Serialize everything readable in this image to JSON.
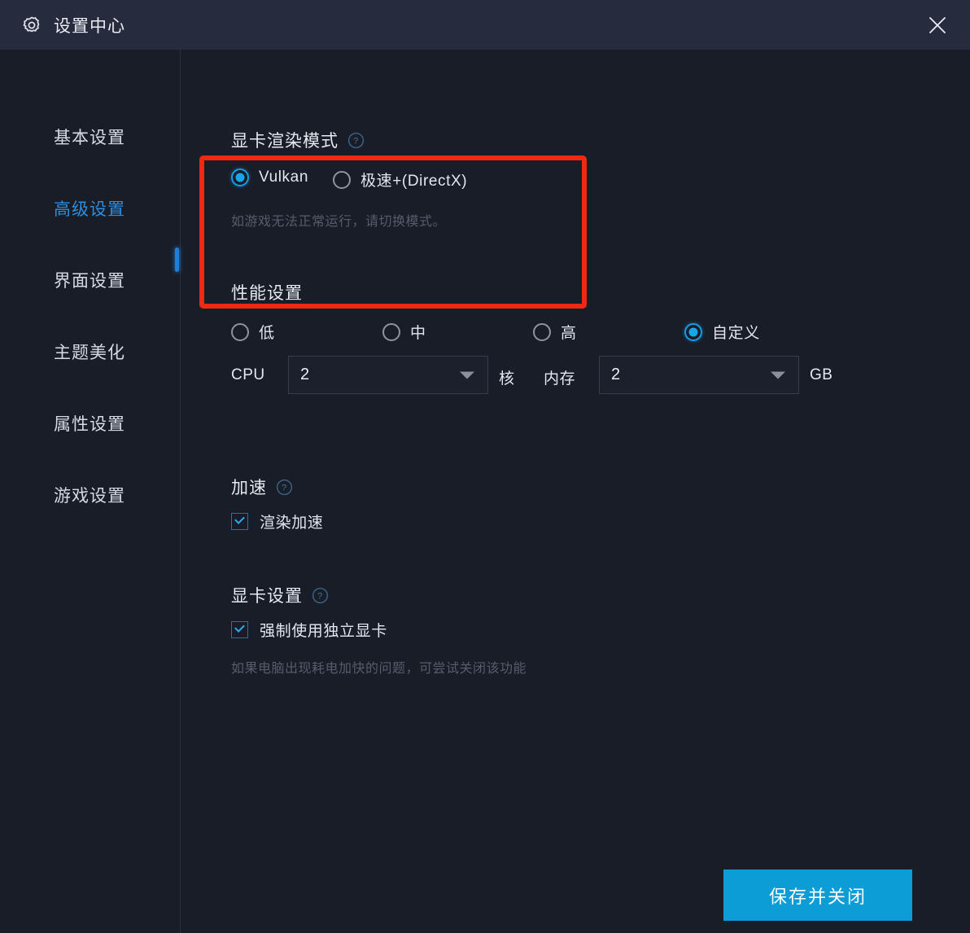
{
  "window": {
    "title": "设置中心",
    "gear_icon": "gear-icon",
    "close_icon": "close-icon",
    "titlebar_color": "#262c3d",
    "background_color": "#191d28",
    "accent_color": "#17a7e8",
    "highlight_color": "#f02a12"
  },
  "sidebar": {
    "items": [
      {
        "label": "基本设置",
        "active": false
      },
      {
        "label": "高级设置",
        "active": true
      },
      {
        "label": "界面设置",
        "active": false
      },
      {
        "label": "主题美化",
        "active": false
      },
      {
        "label": "属性设置",
        "active": false
      },
      {
        "label": "游戏设置",
        "active": false
      }
    ]
  },
  "main": {
    "render_mode": {
      "title": "显卡渲染模式",
      "help_icon": "help-circle-icon",
      "options": [
        {
          "label": "Vulkan",
          "selected": true
        },
        {
          "label": "极速+(DirectX)",
          "selected": false
        }
      ],
      "hint": "如游戏无法正常运行，请切换模式。"
    },
    "performance": {
      "title": "性能设置",
      "options": [
        {
          "label": "低",
          "selected": false
        },
        {
          "label": "中",
          "selected": false
        },
        {
          "label": "高",
          "selected": false
        },
        {
          "label": "自定义",
          "selected": true
        }
      ],
      "cpu": {
        "label": "CPU",
        "value": "2",
        "unit": "核",
        "caret_icon": "chevron-down-icon"
      },
      "memory": {
        "label": "内存",
        "value": "2",
        "unit": "GB",
        "caret_icon": "chevron-down-icon"
      }
    },
    "acceleration": {
      "title": "加速",
      "help_icon": "help-circle-icon",
      "checkbox": {
        "label": "渲染加速",
        "checked": true
      }
    },
    "graphics": {
      "title": "显卡设置",
      "help_icon": "help-circle-icon",
      "checkbox": {
        "label": "强制使用独立显卡",
        "checked": true
      },
      "hint": "如果电脑出现耗电加快的问题，可尝试关闭该功能"
    }
  },
  "footer": {
    "save_label": "保存并关闭"
  }
}
